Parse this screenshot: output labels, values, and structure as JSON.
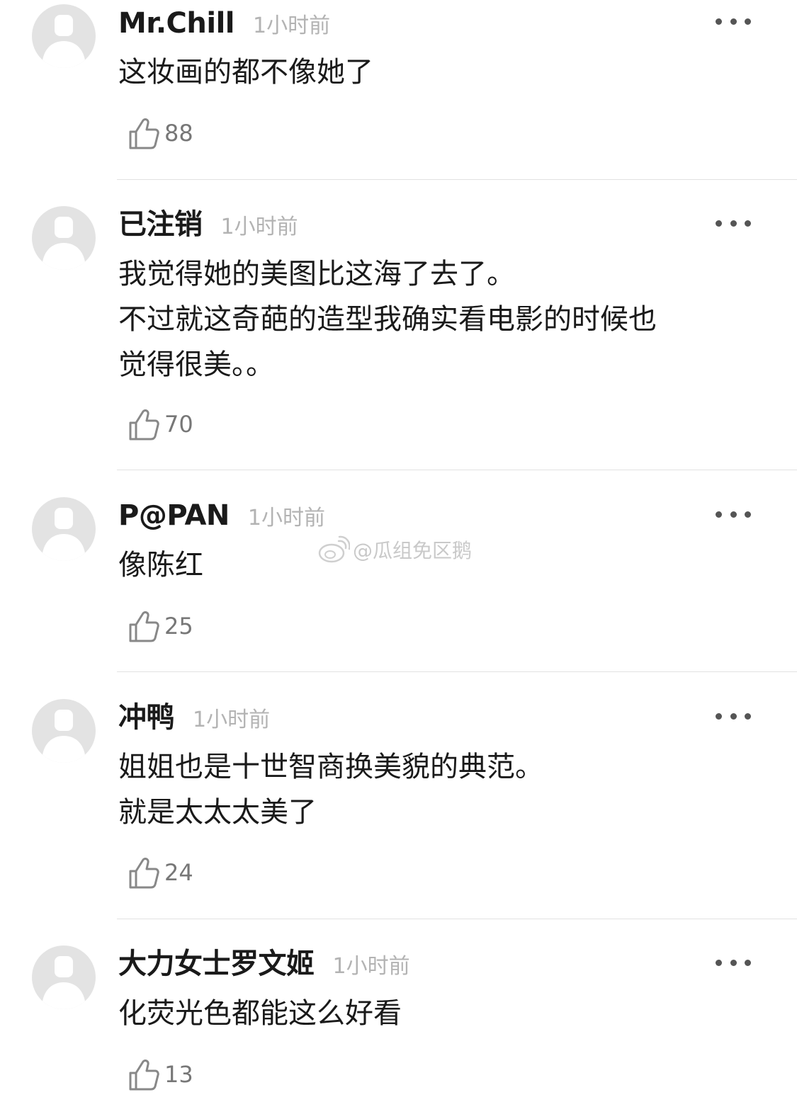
{
  "comments": [
    {
      "username": "Mr.Chill",
      "time": "1小时前",
      "lines": [
        "这妆画的都不像她了"
      ],
      "likes": "88"
    },
    {
      "username": "已注销",
      "time": "1小时前",
      "lines": [
        "我觉得她的美图比这海了去了。",
        "不过就这奇葩的造型我确实看电影的时候也",
        "觉得很美。。"
      ],
      "likes": "70"
    },
    {
      "username": "P@PAN",
      "time": "1小时前",
      "lines": [
        "像陈红"
      ],
      "likes": "25"
    },
    {
      "username": "冲鸭",
      "time": "1小时前",
      "lines": [
        "姐姐也是十世智商换美貌的典范。",
        "就是太太太美了"
      ],
      "likes": "24"
    },
    {
      "username": "大力女士罗文姬",
      "time": "1小时前",
      "lines": [
        "化荧光色都能这么好看"
      ],
      "likes": "13"
    }
  ],
  "watermark": {
    "text": "@瓜组免区鹅",
    "icon": "weibo-logo-icon"
  },
  "icons": {
    "avatar": "default-avatar-icon",
    "like": "thumbs-up-icon",
    "more": "more-options-icon"
  },
  "colors": {
    "username": "#1a1a1a",
    "time": "#b3b3b3",
    "likes": "#777777",
    "divider": "#e2e2e2"
  }
}
